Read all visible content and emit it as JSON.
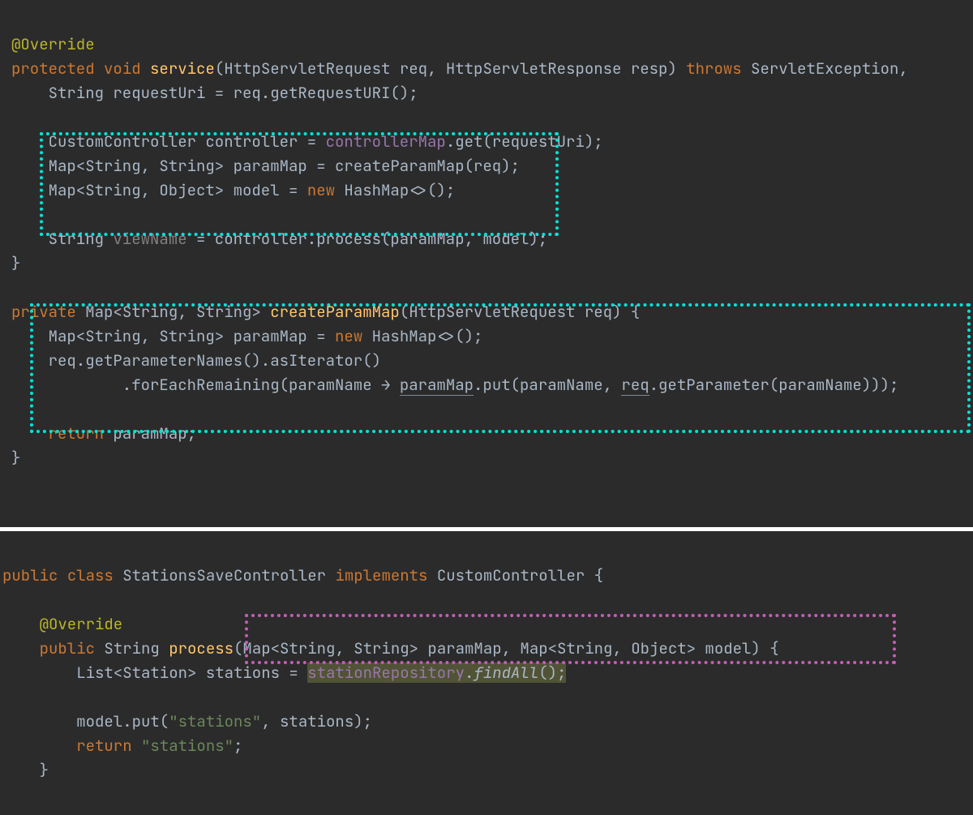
{
  "pane1": {
    "l1_ann": "@Override",
    "l2_kw1": "protected",
    "l2_kw2": "void",
    "l2_fn": "service",
    "l2_sig": "(HttpServletRequest req, HttpServletResponse resp) ",
    "l2_kw3": "throws",
    "l2_tail": " ServletException,",
    "l3_a": "    String requestUri = req.getRequestURI();",
    "l4": "",
    "l5_a": "    CustomController controller = ",
    "l5_fld": "controllerMap",
    "l5_b": ".get(requestUri);",
    "l6_a": "    Map<String, String> paramMap = createParamMap(req);",
    "l7_a": "    Map<String, Object> model = ",
    "l7_kw": "new",
    "l7_b": " HashMap<>();",
    "l8": "",
    "l9_a": "    String ",
    "l9_gy": "viewName",
    "l9_b": " = controller.process(paramMap, model);",
    "l10": "}",
    "l11": "",
    "l12_kw1": "private",
    "l12_sig1": " Map<String, String> ",
    "l12_fn": "createParamMap",
    "l12_sig2": "(HttpServletRequest req) {",
    "l13_a": "    Map<String, String> paramMap = ",
    "l13_kw": "new",
    "l13_b": " HashMap<>();",
    "l14": "    req.getParameterNames().asIterator()",
    "l15_a": "            .forEachRemaining(paramName → ",
    "l15_u1": "paramMap",
    "l15_b": ".put(paramName, ",
    "l15_u2": "req",
    "l15_c": ".getParameter(paramName)));",
    "l16": "",
    "l17_kw": "return",
    "l17_a": " paramMap;",
    "l18": "}"
  },
  "pane2": {
    "l1_kw1": "public",
    "l1_kw2": "class",
    "l1_name": " StationsSaveController ",
    "l1_kw3": "implements",
    "l1_tail": " CustomController {",
    "l2": "",
    "l3_ann": "@Override",
    "l4_kw": "public",
    "l4_a": " String ",
    "l4_fn": "process",
    "l4_sig": "(Map<String, String> paramMap, Map<String, Object> model) {",
    "l5_a": "        List<Station> stations = ",
    "l5_fld": "stationRepository",
    "l5_b": ".",
    "l5_it": "findAll",
    "l5_c": "();",
    "l6": "",
    "l7_a": "        model.put(",
    "l7_s1": "\"stations\"",
    "l7_b": ", stations);",
    "l8_kw": "return",
    "l8_sp": " ",
    "l8_s": "\"stations\"",
    "l8_sc": ";",
    "l9": "    }"
  }
}
